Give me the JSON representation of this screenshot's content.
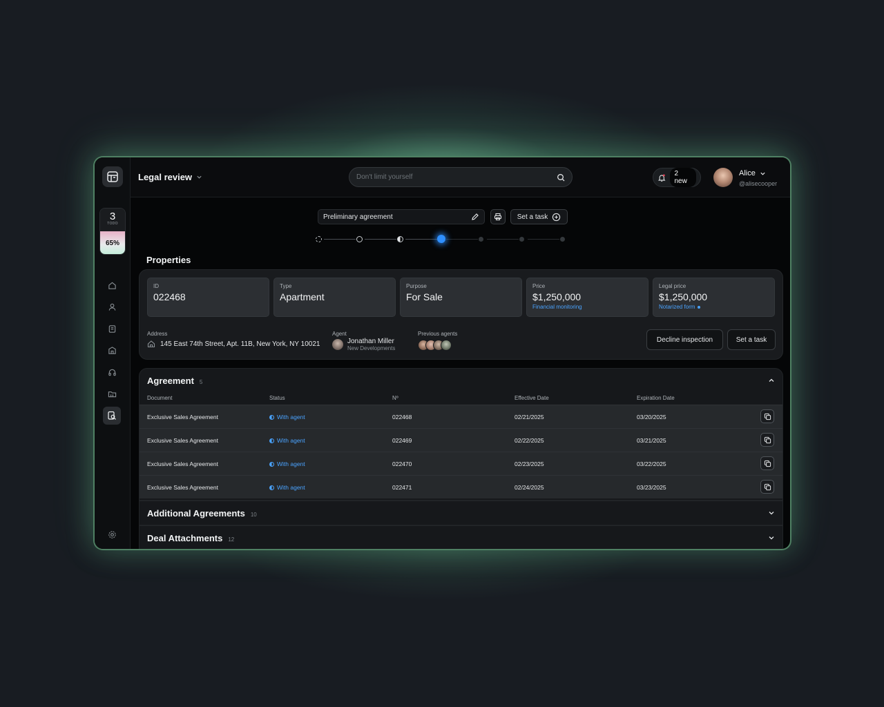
{
  "header": {
    "title": "Legal review",
    "search_placeholder": "Don't limit yourself",
    "notifications": "2 new",
    "user": {
      "name": "Alice",
      "handle": "@alisecooper"
    }
  },
  "sidebar": {
    "todo_count": "3",
    "todo_label": "TODO",
    "todo_progress": "65%",
    "nav_items": [
      "home-icon",
      "user-icon",
      "document-icon",
      "building-icon",
      "headset-icon",
      "folder-icon",
      "contract-search-icon"
    ],
    "settings_icon": "gear-icon"
  },
  "toolbar": {
    "document_value": "Preliminary agreement",
    "set_task_label": "Set a task"
  },
  "stepper": {
    "total_steps": 7,
    "active_step": 4
  },
  "properties": {
    "title": "Properties",
    "cards": [
      {
        "label": "ID",
        "value": "022468",
        "sub": ""
      },
      {
        "label": "Type",
        "value": "Apartment",
        "sub": ""
      },
      {
        "label": "Purpose",
        "value": "For Sale",
        "sub": ""
      },
      {
        "label": "Price",
        "value": "$1,250,000",
        "sub": "Financial monitoring"
      },
      {
        "label": "Legal price",
        "value": "$1,250,000",
        "sub": "Notarized form"
      }
    ],
    "address_label": "Address",
    "address": "145 East 74th Street, Apt. 11B, New York, NY 10021",
    "agent_label": "Agent",
    "agent_name": "Jonathan Miller",
    "agent_role": "New Developments",
    "previous_agents_label": "Previous agents",
    "decline_label": "Decline inspection",
    "set_task_label": "Set a task"
  },
  "agreement": {
    "title": "Agreement",
    "count": "5",
    "columns": [
      "Document",
      "Status",
      "Nº",
      "Effective Date",
      "Expiration Date"
    ],
    "rows": [
      {
        "document": "Exclusive Sales Agreement",
        "status": "With agent",
        "number": "022468",
        "effective": "02/21/2025",
        "expiration": "03/20/2025"
      },
      {
        "document": "Exclusive Sales Agreement",
        "status": "With agent",
        "number": "022469",
        "effective": "02/22/2025",
        "expiration": "03/21/2025"
      },
      {
        "document": "Exclusive Sales Agreement",
        "status": "With agent",
        "number": "022470",
        "effective": "02/23/2025",
        "expiration": "03/22/2025"
      },
      {
        "document": "Exclusive Sales Agreement",
        "status": "With agent",
        "number": "022471",
        "effective": "02/24/2025",
        "expiration": "03/23/2025"
      }
    ]
  },
  "additional_agreements": {
    "title": "Additional Agreements",
    "count": "10"
  },
  "deal_attachments": {
    "title": "Deal Attachments",
    "count": "12"
  },
  "colors": {
    "accent": "#4aa3ff",
    "glow": "#8ce6af"
  }
}
